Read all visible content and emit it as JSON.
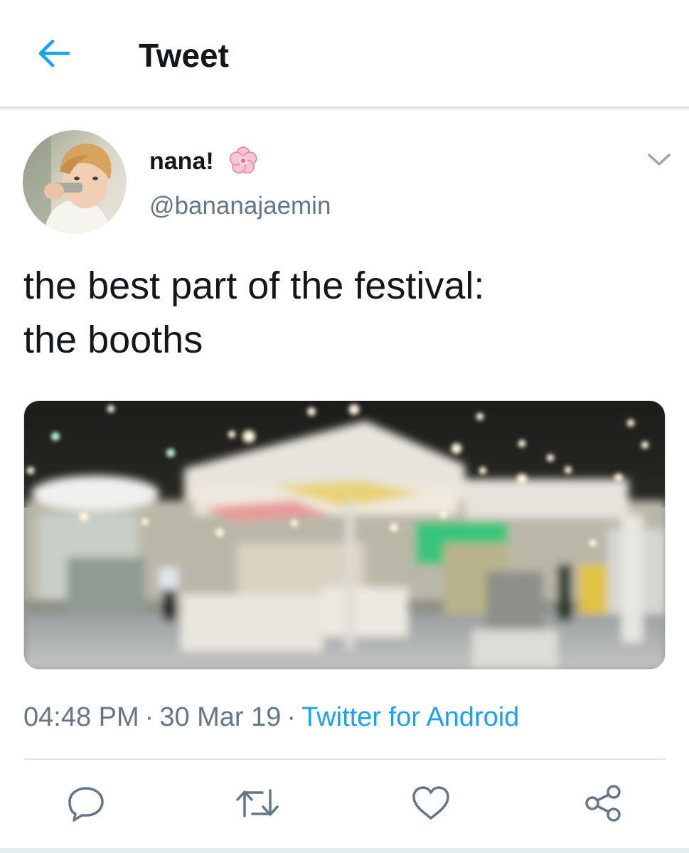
{
  "header": {
    "back_icon": "arrow-left-icon",
    "title": "Tweet"
  },
  "tweet": {
    "author": {
      "display_name": "nana!",
      "name_emoji": "cherry-blossom-icon",
      "handle": "@bananajaemin"
    },
    "more_icon": "chevron-down-icon",
    "text": "the best part of the festival:\nthe booths",
    "time": "04:48 PM",
    "date": "30 Mar 19",
    "separator": "·",
    "source": "Twitter for Android",
    "actions": [
      {
        "name": "reply",
        "icon": "reply-icon"
      },
      {
        "name": "retweet",
        "icon": "retweet-icon"
      },
      {
        "name": "like",
        "icon": "heart-icon"
      },
      {
        "name": "share",
        "icon": "share-icon"
      }
    ]
  },
  "colors": {
    "accent": "#1da1f2",
    "text_primary": "#14171a",
    "text_secondary": "#657786",
    "divider": "#e1e8ed"
  }
}
